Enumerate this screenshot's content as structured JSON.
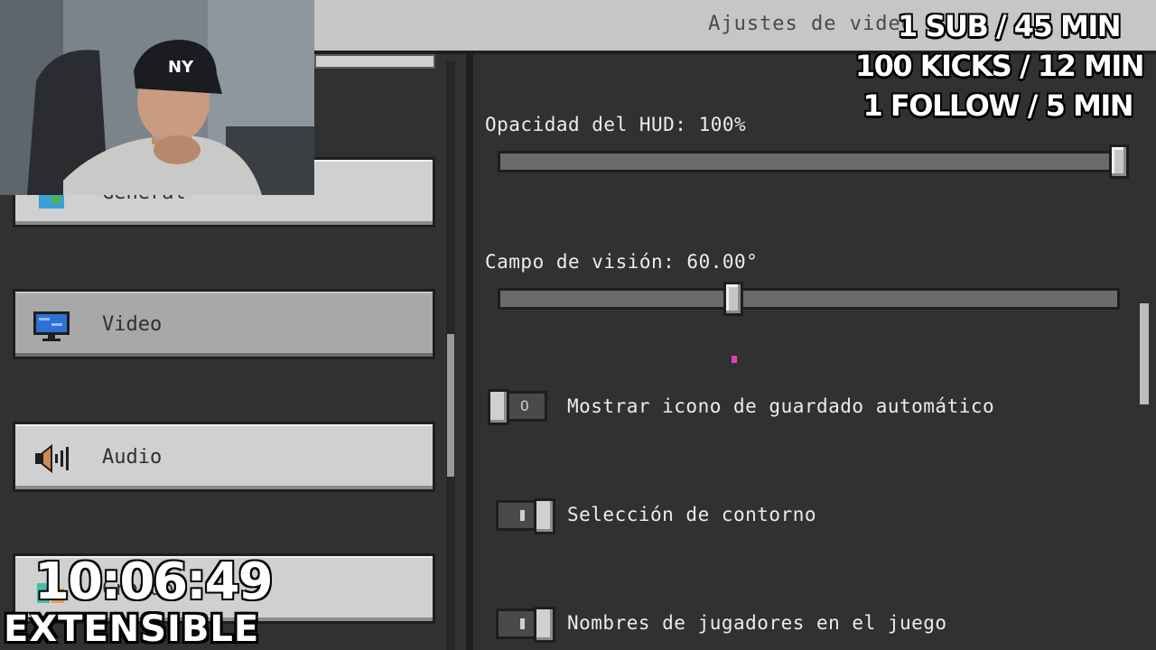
{
  "header": {
    "title": "Ajustes de video"
  },
  "sidebar": {
    "items": [
      {
        "label": "General",
        "icon": "globe-icon",
        "selected": false
      },
      {
        "label": "Video",
        "icon": "monitor-icon",
        "selected": true
      },
      {
        "label": "Audio",
        "icon": "speaker-icon",
        "selected": false
      },
      {
        "label": "Creador",
        "icon": "creator-icon",
        "selected": false
      }
    ]
  },
  "main": {
    "hud_opacity": {
      "label": "Opacidad del HUD: 100%",
      "value_percent": 100
    },
    "fov": {
      "label": "Campo de visión: 60.00°",
      "value_fraction": 0.375
    },
    "toggles": [
      {
        "label": "Mostrar icono de guardado automático",
        "on": false,
        "mark": "O"
      },
      {
        "label": "Selección de contorno",
        "on": true
      },
      {
        "label": "Nombres de jugadores en el juego",
        "on": true
      }
    ]
  },
  "overlay": {
    "goals": [
      "1 SUB / 45 MIN",
      "100 KICKS / 12 MIN",
      "1 FOLLOW / 5 MIN"
    ],
    "timer": "10:06:49",
    "banner": "EXTENSIBLE"
  },
  "colors": {
    "panel": "#313131",
    "button": "#d0d0d0",
    "selected": "#a8a8a8",
    "slider": "#6b6b6b"
  }
}
